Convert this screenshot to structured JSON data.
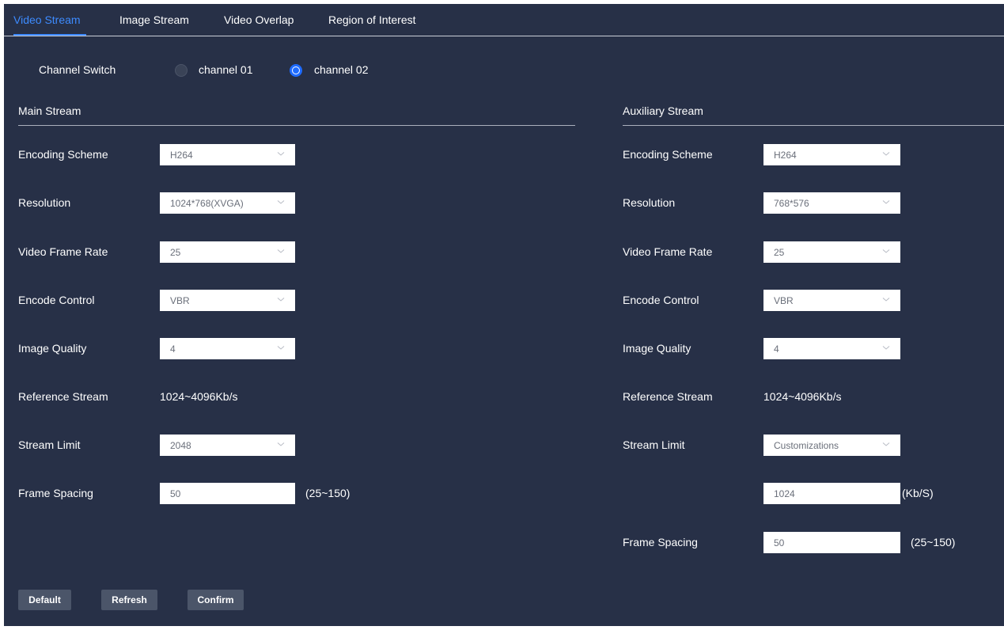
{
  "tabs": [
    "Video Stream",
    "Image Stream",
    "Video Overlap",
    "Region of Interest"
  ],
  "channel_switch": {
    "label": "Channel Switch",
    "options": [
      "channel 01",
      "channel 02"
    ],
    "selected": "channel 02"
  },
  "main": {
    "title": "Main Stream",
    "encoding_scheme": {
      "label": "Encoding Scheme",
      "value": "H264"
    },
    "resolution": {
      "label": "Resolution",
      "value": "1024*768(XVGA)"
    },
    "frame_rate": {
      "label": "Video Frame Rate",
      "value": "25"
    },
    "encode_control": {
      "label": "Encode Control",
      "value": "VBR"
    },
    "image_quality": {
      "label": "Image Quality",
      "value": "4"
    },
    "reference_stream": {
      "label": "Reference Stream",
      "value": "1024~4096Kb/s"
    },
    "stream_limit": {
      "label": "Stream Limit",
      "value": "2048"
    },
    "frame_spacing": {
      "label": "Frame Spacing",
      "value": "50",
      "range": "(25~150)"
    }
  },
  "aux": {
    "title": "Auxiliary Stream",
    "encoding_scheme": {
      "label": "Encoding Scheme",
      "value": "H264"
    },
    "resolution": {
      "label": "Resolution",
      "value": "768*576"
    },
    "frame_rate": {
      "label": "Video Frame Rate",
      "value": "25"
    },
    "encode_control": {
      "label": "Encode Control",
      "value": "VBR"
    },
    "image_quality": {
      "label": "Image Quality",
      "value": "4"
    },
    "reference_stream": {
      "label": "Reference Stream",
      "value": "1024~4096Kb/s"
    },
    "stream_limit": {
      "label": "Stream Limit",
      "value": "Customizations"
    },
    "custom_bitrate": {
      "value": "1024",
      "unit": "(Kb/S)"
    },
    "frame_spacing": {
      "label": "Frame Spacing",
      "value": "50",
      "range": "(25~150)"
    }
  },
  "buttons": {
    "default": "Default",
    "refresh": "Refresh",
    "confirm": "Confirm"
  },
  "colors": {
    "background": "#273047",
    "accent": "#3d8bff",
    "button": "#4b5569"
  }
}
